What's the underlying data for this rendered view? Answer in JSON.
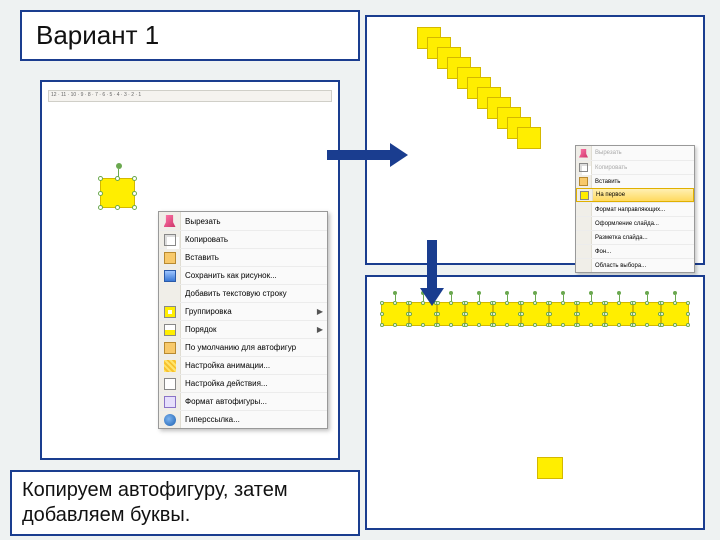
{
  "title": "Вариант 1",
  "caption": "Копируем автофигуру, затем добавляем буквы.",
  "ruler_text": "12 · 11 · 10 · 9 · 8 · 7 · 6 · 5 · 4 · 3 · 2 · 1",
  "ctx_menu": [
    {
      "label": "Вырезать",
      "icon": "ico-cut",
      "muted": false,
      "arrow": false
    },
    {
      "label": "Копировать",
      "icon": "ico-copy",
      "muted": false,
      "arrow": false
    },
    {
      "label": "Вставить",
      "icon": "ico-paste",
      "muted": false,
      "arrow": false
    },
    {
      "label": "Сохранить как рисунок...",
      "icon": "ico-save-pic",
      "muted": false,
      "arrow": false
    },
    {
      "label": "Добавить текстовую строку",
      "icon": "",
      "muted": false,
      "arrow": false
    },
    {
      "label": "Группировка",
      "icon": "ico-group",
      "muted": false,
      "arrow": true
    },
    {
      "label": "Порядок",
      "icon": "ico-order",
      "muted": false,
      "arrow": true
    },
    {
      "label": "По умолчанию для автофигур",
      "icon": "ico-default",
      "muted": false,
      "arrow": false
    },
    {
      "label": "Настройка анимации...",
      "icon": "ico-custom",
      "muted": false,
      "arrow": false
    },
    {
      "label": "Настройка действия...",
      "icon": "ico-action",
      "muted": false,
      "arrow": false
    },
    {
      "label": "Формат автофигуры...",
      "icon": "ico-format",
      "muted": false,
      "arrow": false
    },
    {
      "label": "Гиперссылка...",
      "icon": "ico-link",
      "muted": false,
      "arrow": false
    }
  ],
  "mini_menu": [
    {
      "label": "Вырезать",
      "icon": "ico-cut",
      "muted": true,
      "hl": false
    },
    {
      "label": "Копировать",
      "icon": "ico-copy",
      "muted": true,
      "hl": false
    },
    {
      "label": "Вставить",
      "icon": "ico-paste",
      "muted": false,
      "hl": false
    },
    {
      "label": "На первое",
      "icon": "ico-ontop",
      "muted": false,
      "hl": true
    },
    {
      "label": "Формат направляющих...",
      "icon": "",
      "muted": false,
      "hl": false
    },
    {
      "label": "Оформление слайда...",
      "icon": "",
      "muted": false,
      "hl": false
    },
    {
      "label": "Разметка слайда...",
      "icon": "",
      "muted": false,
      "hl": false
    },
    {
      "label": "Фон...",
      "icon": "",
      "muted": false,
      "hl": false
    },
    {
      "label": "Область выбора...",
      "icon": "",
      "muted": false,
      "hl": false
    }
  ],
  "diagonal_count": 11,
  "row_count": 11
}
